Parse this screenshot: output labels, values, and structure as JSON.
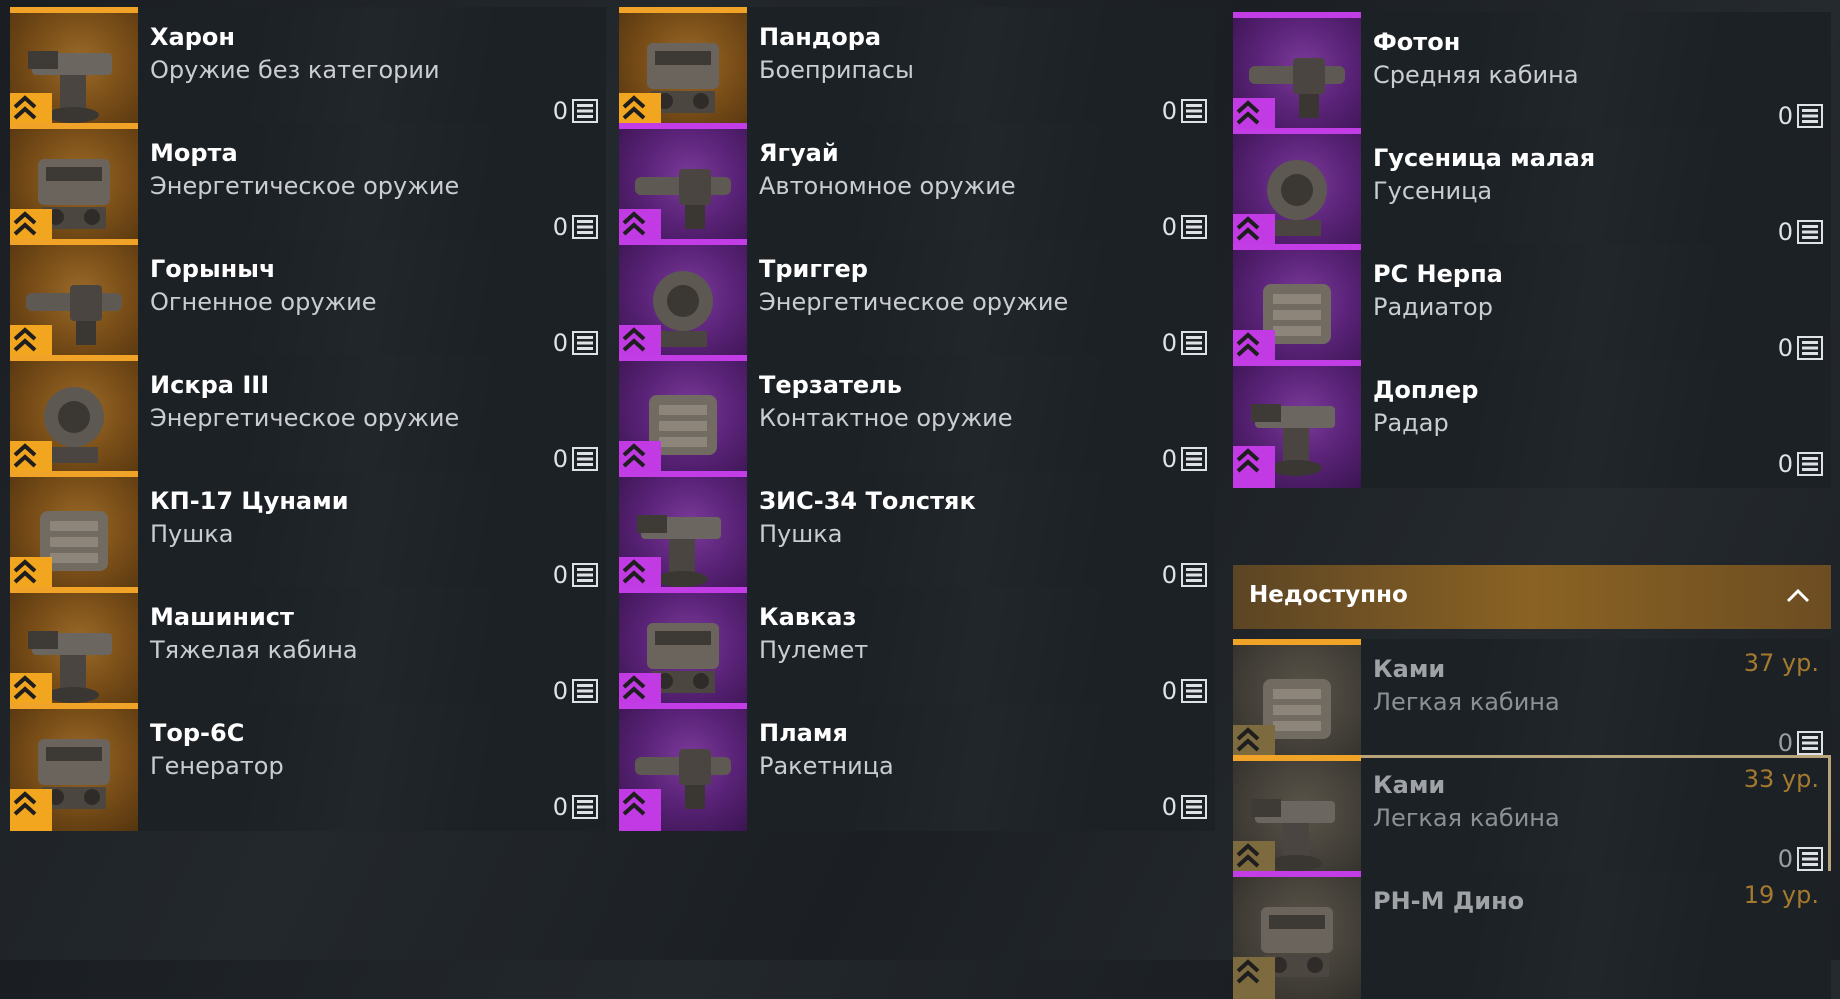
{
  "columns": [
    {
      "items": [
        {
          "name": "Харон",
          "category": "Оружие без категории",
          "count": "0",
          "rarity": "orange"
        },
        {
          "name": "Морта",
          "category": "Энергетическое оружие",
          "count": "0",
          "rarity": "orange"
        },
        {
          "name": "Горыныч",
          "category": "Огненное оружие",
          "count": "0",
          "rarity": "orange"
        },
        {
          "name": "Искра III",
          "category": "Энергетическое оружие",
          "count": "0",
          "rarity": "orange"
        },
        {
          "name": "КП-17 Цунами",
          "category": "Пушка",
          "count": "0",
          "rarity": "orange"
        },
        {
          "name": "Машинист",
          "category": "Тяжелая кабина",
          "count": "0",
          "rarity": "orange"
        },
        {
          "name": "Тор-6С",
          "category": "Генератор",
          "count": "0",
          "rarity": "orange"
        }
      ]
    },
    {
      "items": [
        {
          "name": "Пандора",
          "category": "Боеприпасы",
          "count": "0",
          "rarity": "orange"
        },
        {
          "name": "Ягуай",
          "category": "Автономное оружие",
          "count": "0",
          "rarity": "purple"
        },
        {
          "name": "Триггер",
          "category": "Энергетическое оружие",
          "count": "0",
          "rarity": "purple"
        },
        {
          "name": "Терзатель",
          "category": "Контактное оружие",
          "count": "0",
          "rarity": "purple"
        },
        {
          "name": "ЗИС-34 Толстяк",
          "category": "Пушка",
          "count": "0",
          "rarity": "purple"
        },
        {
          "name": "Кавказ",
          "category": "Пулемет",
          "count": "0",
          "rarity": "purple"
        },
        {
          "name": "Пламя",
          "category": "Ракетница",
          "count": "0",
          "rarity": "purple"
        }
      ]
    },
    {
      "items": [
        {
          "name": "Фотон",
          "category": "Средняя кабина",
          "count": "0",
          "rarity": "purple"
        },
        {
          "name": "Гусеница малая",
          "category": "Гусеница",
          "count": "0",
          "rarity": "purple"
        },
        {
          "name": "РС Нерпа",
          "category": "Радиатор",
          "count": "0",
          "rarity": "purple"
        },
        {
          "name": "Доплер",
          "category": "Радар",
          "count": "0",
          "rarity": "purple"
        }
      ],
      "unavailable_section": {
        "title": "Недоступно",
        "items": [
          {
            "name": "Ками",
            "category": "Легкая кабина",
            "count": "0",
            "level": "37 ур.",
            "rarity": "orange"
          },
          {
            "name": "Ками",
            "category": "Легкая кабина",
            "count": "0",
            "level": "33 ур.",
            "rarity": "orange",
            "selected": true
          },
          {
            "name": "РН-М Дино",
            "category": "",
            "count": "",
            "level": "19 ур.",
            "rarity": "purple"
          }
        ]
      }
    }
  ],
  "icons": {
    "rarity": "chevron-double-up-icon",
    "count": "list-icon",
    "collapse": "chevron-up-icon"
  },
  "colors": {
    "orange": "#f2a51f",
    "purple": "#c13ae4",
    "header": "#8a6223"
  }
}
